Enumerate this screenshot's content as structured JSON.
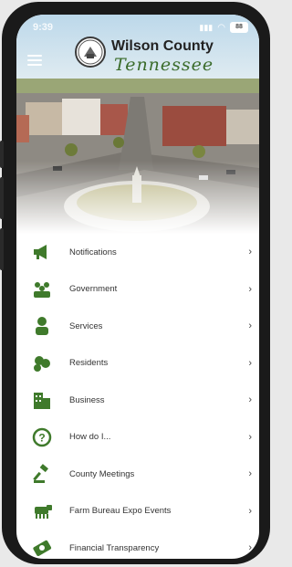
{
  "status_bar": {
    "time": "9:39",
    "battery": "88"
  },
  "header": {
    "title_line1": "Wilson County",
    "title_line2": "Tennessee"
  },
  "menu": {
    "items": [
      {
        "label": "Notifications",
        "icon": "megaphone-icon"
      },
      {
        "label": "Government",
        "icon": "people-group-icon"
      },
      {
        "label": "Services",
        "icon": "service-person-icon"
      },
      {
        "label": "Residents",
        "icon": "residents-icon"
      },
      {
        "label": "Business",
        "icon": "buildings-icon"
      },
      {
        "label": "How do I...",
        "icon": "question-icon"
      },
      {
        "label": "County Meetings",
        "icon": "gavel-icon"
      },
      {
        "label": "Farm Bureau Expo Events",
        "icon": "cow-icon"
      },
      {
        "label": "Financial Transparency",
        "icon": "money-icon"
      }
    ],
    "chevron": "›"
  },
  "colors": {
    "accent_green": "#3f7a2b",
    "text": "#333333"
  }
}
